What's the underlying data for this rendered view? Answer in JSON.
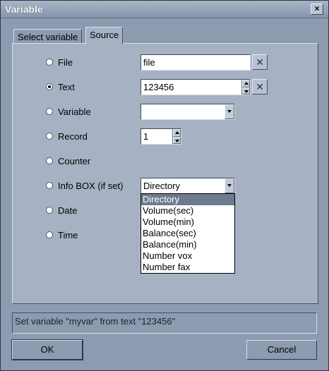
{
  "window": {
    "title": "Variable",
    "close_glyph": "×"
  },
  "tabs": [
    {
      "label": "Select variable",
      "active": false
    },
    {
      "label": "Source",
      "active": true
    }
  ],
  "options": {
    "file": {
      "label": "File",
      "value": "file",
      "selected": false
    },
    "text": {
      "label": "Text",
      "value": "123456",
      "selected": true
    },
    "variable": {
      "label": "Variable",
      "value": "",
      "selected": false
    },
    "record": {
      "label": "Record",
      "value": "1",
      "selected": false
    },
    "counter": {
      "label": "Counter",
      "selected": false
    },
    "infobox": {
      "label": "Info BOX (if set)",
      "value": "Directory",
      "selected": false
    },
    "date": {
      "label": "Date",
      "selected": false
    },
    "time": {
      "label": "Time",
      "selected": false
    }
  },
  "clear_glyph": "✕",
  "infobox_options": [
    "Directory",
    "Volume(sec)",
    "Volume(min)",
    "Balance(sec)",
    "Balance(min)",
    "Number vox",
    "Number fax"
  ],
  "status": "Set variable \"myvar\" from text \"123456\"",
  "buttons": {
    "ok": "OK",
    "cancel": "Cancel"
  }
}
